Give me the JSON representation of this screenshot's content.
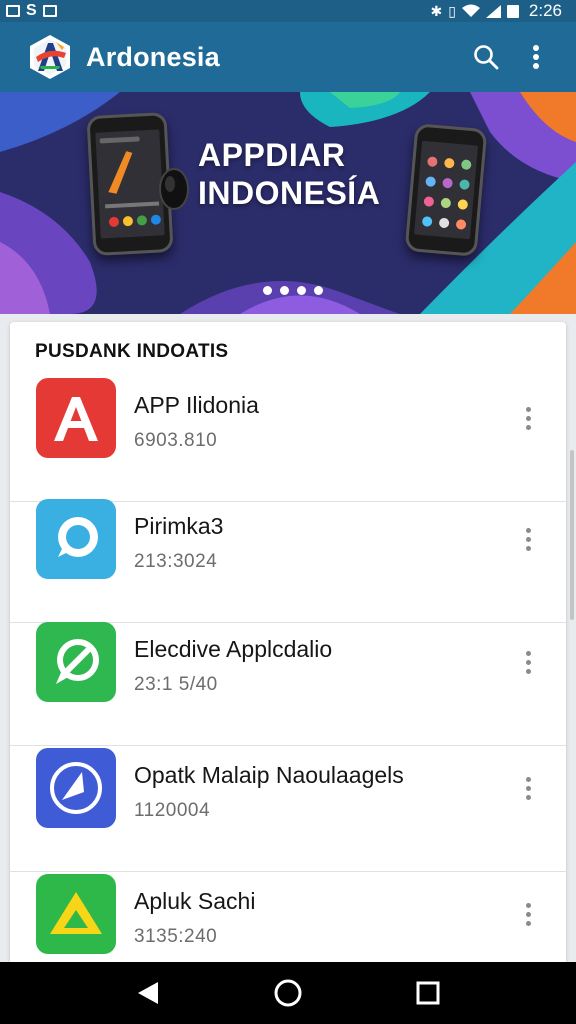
{
  "status_bar": {
    "left_letter": "S",
    "time": "2:26"
  },
  "app_bar": {
    "title": "Ardonesia",
    "icons": [
      "logo-icon",
      "search-icon",
      "overflow-menu-icon"
    ]
  },
  "banner": {
    "title_line1": "APPDIAR",
    "title_line2": "INDONESÍA",
    "slide_count": 4,
    "colors": {
      "bg": "#2d2f6e",
      "teal": "#22b8c8",
      "purple": "#7a4fc4",
      "orange": "#f07a2a",
      "green": "#3cc98c"
    }
  },
  "section": {
    "title": "PUSDANK INDOATIS"
  },
  "apps": [
    {
      "name": "APP Ilidonia",
      "count": "6903.810",
      "icon": "letter-a-icon",
      "color": "#e53935"
    },
    {
      "name": "Pirimka3",
      "count": "213:3024",
      "icon": "chat-bubble-icon",
      "color": "#3ab0e2"
    },
    {
      "name": "Elecdive Applcdalio",
      "count": "23:1 5/40",
      "icon": "no-symbol-icon",
      "color": "#2eb84f"
    },
    {
      "name": "Opatk Malaip Naoulaagels",
      "count": "1120004",
      "icon": "compass-arrow-icon",
      "color": "#3f5bd6"
    },
    {
      "name": "Apluk Sachi",
      "count": "3135:240",
      "icon": "triangle-drive-icon",
      "color": "#2fb84a"
    }
  ],
  "nav_bar": {
    "icons": [
      "back-icon",
      "home-icon",
      "recents-icon"
    ]
  }
}
